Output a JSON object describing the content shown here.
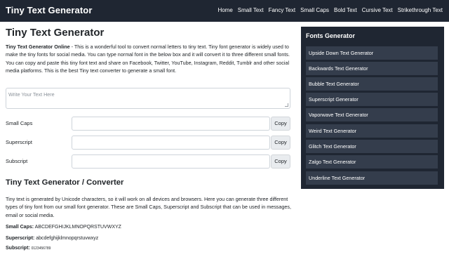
{
  "header": {
    "brand": "Tiny Text Generator",
    "nav": [
      "Home",
      "Small Text",
      "Fancy Text",
      "Small Caps",
      "Bold Text",
      "Cursive Text",
      "Strikethrough Text"
    ]
  },
  "main": {
    "title": "Tiny Text Generator",
    "intro_bold": "Tiny Text Generator Online",
    "intro_text": " - This is a wonderful tool to convert normal letters to tiny text. Tiny font generator is widely used to make the tiny fonts for social media. You can type normal font in the below box and it will convert it to three different small fonts. You can copy and paste this tiny font text and share on Facebook, Twitter, YouTube, Instagram, Reddit, Tumblr and other social media platforms. This is the best Tiny text converter to generate a small font.",
    "input_placeholder": "Write Your Text Here",
    "rows": [
      {
        "label": "Small Caps",
        "copy": "Copy"
      },
      {
        "label": "Superscript",
        "copy": "Copy"
      },
      {
        "label": "Subscript",
        "copy": "Copy"
      }
    ],
    "section_title": "Tiny Text Generator / Converter",
    "section_text": "Tiny text is generated by Unicode characters, so it will work on all devices and browsers. Here you can generate three different types of tiny font from our small font generator. These are Small Caps, Superscript and Subscript that can be used in messages, email or social media.",
    "examples": [
      {
        "label": "Small Caps:",
        "value": "ABCDEFGHIJKLMNOPQRSTUVWXYZ"
      },
      {
        "label": "Superscript:",
        "value": "abcdefghijklmnopqrstuvwxyz"
      },
      {
        "label": "Subscript:",
        "value": "0123456789"
      }
    ]
  },
  "sidebar": {
    "title": "Fonts Generator",
    "items": [
      "Upside Down Text Generator",
      "Backwards Text Generator",
      "Bubble Text Generator",
      "Superscript Generator",
      "Vaporwave Text Generator",
      "Weird Text Generator",
      "Glitch Text Generator",
      "Zalgo Text Generator",
      "Underline Text Generator"
    ]
  }
}
